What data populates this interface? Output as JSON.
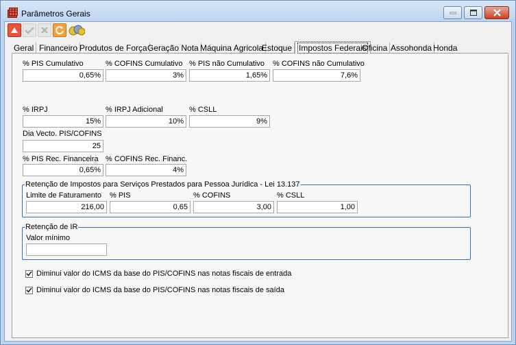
{
  "window": {
    "title": "Parâmetros Gerais"
  },
  "tabs": [
    "Geral",
    "Financeiro",
    "Produtos de Força",
    "Geração Nota",
    "Máquina Agricola",
    "Estoque",
    "Impostos Federais",
    "Oficina",
    "Assohonda",
    "Honda"
  ],
  "active_tab": "Impostos Federais",
  "fields": {
    "pis_cumulativo": {
      "label": "% PIS Cumulativo",
      "value": "0,65%"
    },
    "cofins_cumulativo": {
      "label": "% COFINS Cumulativo",
      "value": "3%"
    },
    "pis_nao_cumulativo": {
      "label": "% PIS não Cumulativo",
      "value": "1,65%"
    },
    "cofins_nao_cumulativo": {
      "label": "% COFINS não Cumulativo",
      "value": "7,6%"
    },
    "irpj": {
      "label": "% IRPJ",
      "value": "15%"
    },
    "irpj_adicional": {
      "label": "% IRPJ Adicional",
      "value": "10%"
    },
    "csll": {
      "label": "% CSLL",
      "value": "9%"
    },
    "dia_vecto": {
      "label": "Dia Vecto. PIS/COFINS",
      "value": "25"
    },
    "pis_rec_fin": {
      "label": "% PIS Rec. Financeira",
      "value": "0,65%"
    },
    "cofins_rec_fin": {
      "label": "% COFINS Rec. Financ.",
      "value": "4%"
    }
  },
  "retencao_servicos": {
    "title": "Retenção de Impostos para Serviços Prestados para Pessoa Jurídica - Lei 13.137",
    "limite": {
      "label": "Limite de Faturamento",
      "value": "216,00"
    },
    "pis": {
      "label": "% PIS",
      "value": "0,65"
    },
    "cofins": {
      "label": "% COFINS",
      "value": "3,00"
    },
    "csll": {
      "label": "% CSLL",
      "value": "1,00"
    }
  },
  "retencao_ir": {
    "title": "Retenção de IR",
    "valor_minimo": {
      "label": "Valor mínimo",
      "value": ""
    }
  },
  "checkboxes": [
    {
      "label": "Diminui valor do ICMS da base do PIS/COFINS nas notas fiscais de entrada",
      "checked": true
    },
    {
      "label": "Diminui valor do ICMS da base do PIS/COFINS nas notas fiscais de saída",
      "checked": true
    }
  ],
  "colors": {
    "title_bar": "#bcd4ee",
    "group_border": "#2e6fb0",
    "close_button": "#c8432b"
  }
}
